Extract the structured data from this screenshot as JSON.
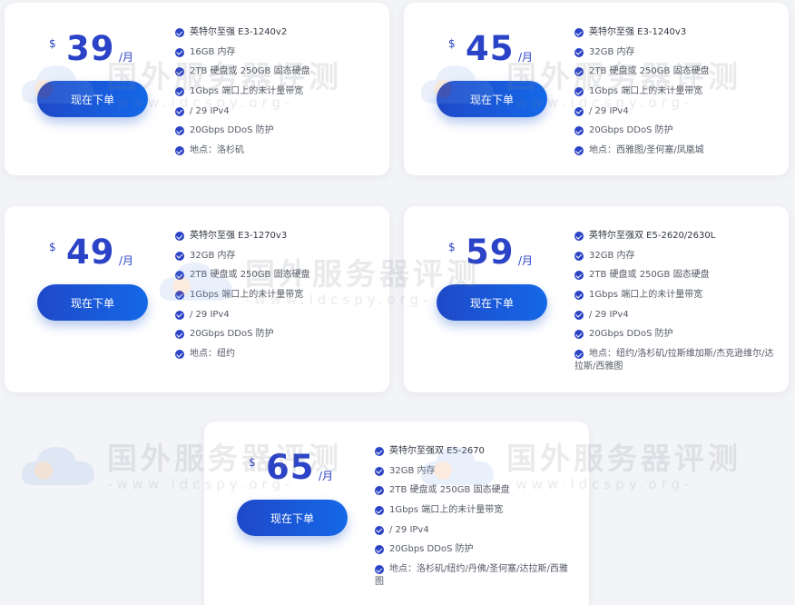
{
  "watermark": {
    "title": "国外服务器评测",
    "url": "-www.idcspy.org-"
  },
  "plans": [
    {
      "currency": "$",
      "price": "39",
      "per": "/月",
      "button": "现在下单",
      "features": [
        "英特尔至强 E3-1240v2",
        "16GB 内存",
        "2TB 硬盘或 250GB 固态硬盘",
        "1Gbps 端口上的未计量带宽",
        "/ 29 IPv4",
        "20Gbps DDoS 防护",
        "地点：洛杉矶"
      ]
    },
    {
      "currency": "$",
      "price": "45",
      "per": "/月",
      "button": "现在下单",
      "features": [
        "英特尔至强 E3-1240v3",
        "32GB 内存",
        "2TB 硬盘或 250GB 固态硬盘",
        "1Gbps 端口上的未计量带宽",
        "/ 29 IPv4",
        "20Gbps DDoS 防护",
        "地点：西雅图/圣何塞/凤凰城"
      ]
    },
    {
      "currency": "$",
      "price": "49",
      "per": "/月",
      "button": "现在下单",
      "features": [
        "英特尔至强 E3-1270v3",
        "32GB 内存",
        "2TB 硬盘或 250GB 固态硬盘",
        "1Gbps 端口上的未计量带宽",
        "/ 29 IPv4",
        "20Gbps DDoS 防护",
        "地点：纽约"
      ]
    },
    {
      "currency": "$",
      "price": "59",
      "per": "/月",
      "button": "现在下单",
      "features": [
        "英特尔至强双 E5-2620/2630L",
        "32GB 内存",
        "2TB 硬盘或 250GB 固态硬盘",
        "1Gbps 端口上的未计量带宽",
        "/ 29 IPv4",
        "20Gbps DDoS 防护",
        "地点：纽约/洛杉矶/拉斯维加斯/杰克逊维尔/达拉斯/西雅图"
      ]
    },
    {
      "currency": "$",
      "price": "65",
      "per": "/月",
      "button": "现在下单",
      "features": [
        "英特尔至强双 E5-2670",
        "32GB 内存",
        "2TB 硬盘或 250GB 固态硬盘",
        "1Gbps 端口上的未计量带宽",
        "/ 29 IPv4",
        "20Gbps DDoS 防护",
        "地点：洛杉矶/纽约/丹佛/圣何塞/达拉斯/西雅图"
      ]
    }
  ],
  "colors": {
    "accent": "#2b43c6",
    "button_start": "#1f49c8",
    "button_end": "#1468e8"
  }
}
